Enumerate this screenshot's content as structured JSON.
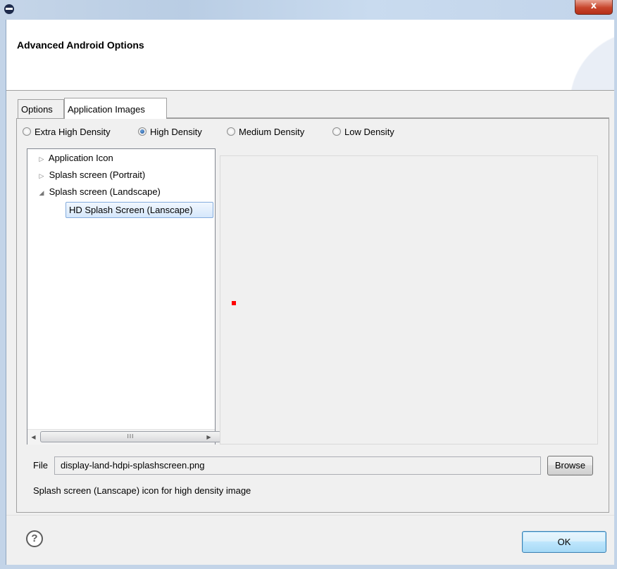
{
  "window": {
    "close_glyph": "x"
  },
  "header": {
    "title": "Advanced Android Options"
  },
  "tabs": [
    {
      "label": "Options"
    },
    {
      "label": "Application Images"
    }
  ],
  "density": {
    "options": [
      "Extra High Density",
      "High Density",
      "Medium Density",
      "Low Density"
    ],
    "selected": "High Density"
  },
  "tree": {
    "items": [
      {
        "label": "Application Icon",
        "expander": "▷"
      },
      {
        "label": "Splash screen (Portrait)",
        "expander": "▷"
      },
      {
        "label": "Splash screen (Landscape)",
        "expander": "◢"
      }
    ],
    "selected_child": "HD Splash Screen (Lanscape)",
    "scroll_grip": "III"
  },
  "file": {
    "label": "File",
    "value": "display-land-hdpi-splashscreen.png",
    "browse_label": "Browse"
  },
  "description": "Splash screen (Lanscape) icon for high density image",
  "footer": {
    "help_glyph": "?",
    "ok_label": "OK"
  },
  "colors": {
    "accent_red": "#ff0000",
    "selection_border": "#84acdd",
    "titlebar": "#c5d5e8"
  }
}
